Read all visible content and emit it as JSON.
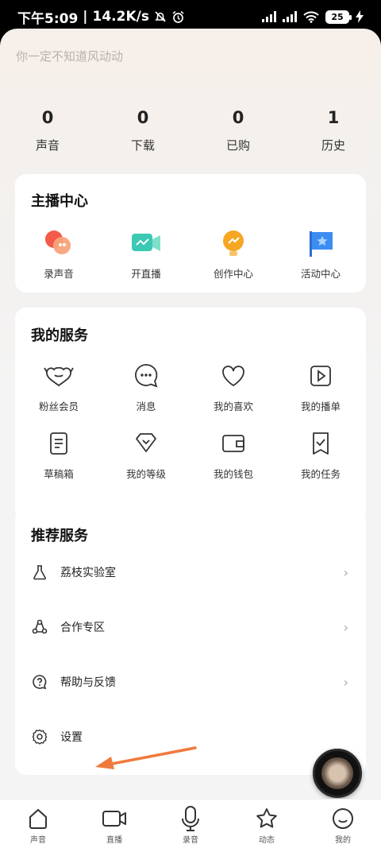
{
  "status_bar": {
    "time": "下午5:09",
    "speed": "14.2K/s",
    "battery": "25"
  },
  "profile": {
    "signature": "你一定不知道风动动"
  },
  "stats": [
    {
      "value": "0",
      "label": "声音"
    },
    {
      "value": "0",
      "label": "下载"
    },
    {
      "value": "0",
      "label": "已购"
    },
    {
      "value": "1",
      "label": "历史"
    }
  ],
  "anchor_center": {
    "title": "主播中心",
    "items": [
      {
        "label": "录声音",
        "icon": "record-voice-icon"
      },
      {
        "label": "开直播",
        "icon": "live-camera-icon"
      },
      {
        "label": "创作中心",
        "icon": "creation-bulb-icon"
      },
      {
        "label": "活动中心",
        "icon": "activity-flag-icon"
      }
    ]
  },
  "my_services": {
    "title": "我的服务",
    "items": [
      {
        "label": "粉丝会员",
        "icon": "fan-member-icon"
      },
      {
        "label": "消息",
        "icon": "message-icon"
      },
      {
        "label": "我的喜欢",
        "icon": "heart-icon"
      },
      {
        "label": "我的播单",
        "icon": "playlist-icon"
      },
      {
        "label": "草稿箱",
        "icon": "draft-icon"
      },
      {
        "label": "我的等级",
        "icon": "level-icon"
      },
      {
        "label": "我的钱包",
        "icon": "wallet-icon"
      },
      {
        "label": "我的任务",
        "icon": "task-icon"
      }
    ]
  },
  "recommended": {
    "title": "推荐服务",
    "items": [
      {
        "label": "荔枝实验室",
        "icon": "flask-icon"
      },
      {
        "label": "合作专区",
        "icon": "cooperation-icon"
      },
      {
        "label": "帮助与反馈",
        "icon": "help-icon"
      },
      {
        "label": "设置",
        "icon": "gear-icon"
      }
    ],
    "chevron": "›"
  },
  "bottom_nav": [
    {
      "label": "声音",
      "icon": "home-icon"
    },
    {
      "label": "直播",
      "icon": "live-icon"
    },
    {
      "label": "录音",
      "icon": "microphone-icon"
    },
    {
      "label": "动态",
      "icon": "star-icon"
    },
    {
      "label": "我的",
      "icon": "profile-icon"
    }
  ],
  "colors": {
    "arrow": "#f07a3e",
    "accent_orange": "#f5a623",
    "accent_teal": "#3cc9b4",
    "accent_blue": "#3d8cf0",
    "accent_red": "#f25a4a"
  }
}
